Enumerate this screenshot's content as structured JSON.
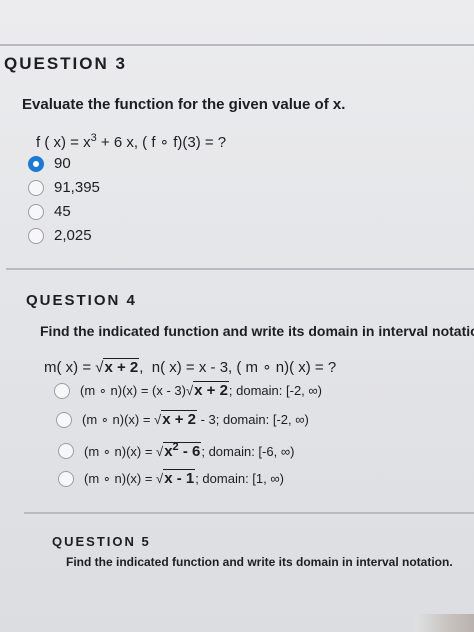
{
  "q3": {
    "title": "QUESTION 3",
    "stem": "Evaluate the function for the given value of x.",
    "prompt": "f(x) = x³ + 6x, (f ∘ f)(3) = ?",
    "options": [
      "90",
      "91,395",
      "45",
      "2,025"
    ],
    "selected_index": 0
  },
  "q4": {
    "title": "QUESTION 4",
    "stem": "Find the indicated function and write its domain in interval notation",
    "prompt": "m(x) = √(x + 2),  n(x) = x - 3, (m ∘ n)(x) = ?",
    "options": [
      "(m ∘ n)(x) = (x - 3)√(x + 2); domain: [-2, ∞)",
      "(m ∘ n)(x) = √(x + 2) - 3; domain: [-2, ∞)",
      "(m ∘ n)(x) = √(x² - 6); domain: [-6, ∞)",
      "(m ∘ n)(x) = √(x - 1); domain: [1, ∞)"
    ],
    "selected_index": null
  },
  "q5": {
    "title": "QUESTION 5",
    "stem": "Find the indicated function and write its domain in interval notation."
  },
  "colors": {
    "selected_radio": "#1a7bd6",
    "divider": "#b9bbc0"
  },
  "icons": {
    "selected": "radio-selected-icon",
    "unselected": "radio-unselected-icon"
  }
}
